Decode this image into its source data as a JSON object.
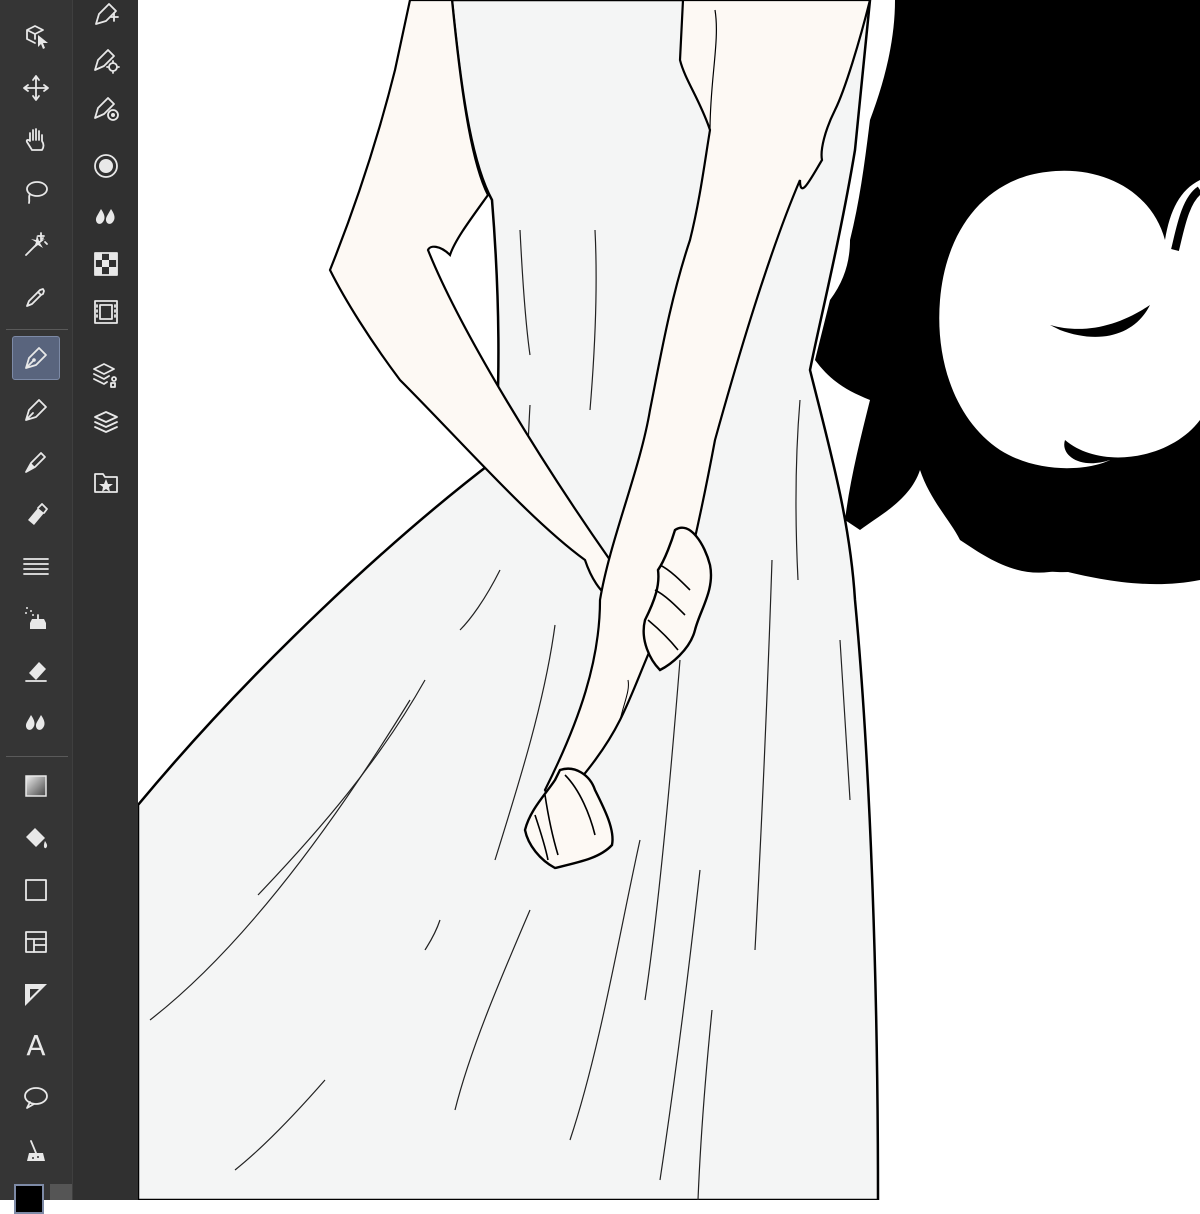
{
  "toolbar": {
    "active_tool": "pen",
    "text_tool_glyph": "A",
    "tools": [
      "operation-tool",
      "move-layer-tool",
      "hand-tool",
      "lasso-tool",
      "magic-wand-tool",
      "eyedropper-tool",
      "pen-tool",
      "pencil-tool",
      "brush-tool",
      "marker-tool",
      "ruler-lines-tool",
      "airbrush-tool",
      "eraser-tool",
      "blend-tool",
      "gradient-tool",
      "fill-tool",
      "shape-tool",
      "frame-tool",
      "ruler-tool",
      "text-tool",
      "balloon-tool",
      "correct-line-tool"
    ]
  },
  "subtoolbar": {
    "items": [
      "vector-edit",
      "vector-settings",
      "vector-target",
      "circle-ring",
      "drops",
      "checker",
      "film",
      "layer-settings",
      "layers",
      "star-folder"
    ]
  },
  "colors": {
    "toolbar_bg": "#353535",
    "subtoolbar_bg": "#303030",
    "active_tool_bg": "#59647d",
    "canvas_bg": "#ffffff",
    "skin_tone": "#fdf9f4",
    "dress_fill": "#f4f5f5",
    "hair": "#000000",
    "main_color": "#000000"
  }
}
